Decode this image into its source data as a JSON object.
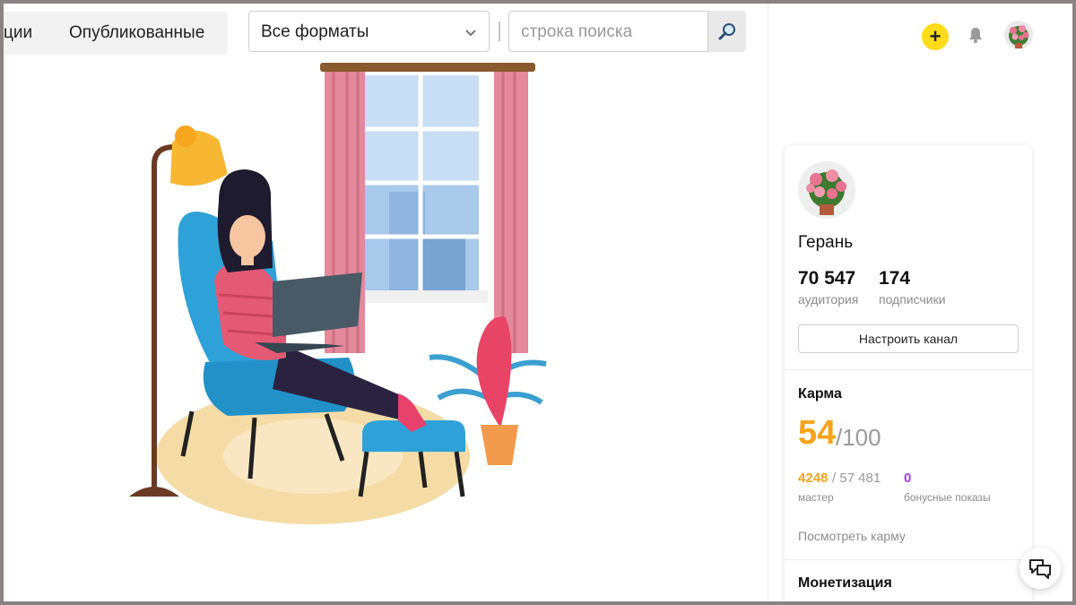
{
  "tabs": {
    "cut_label": "ции",
    "published_label": "Опубликованные"
  },
  "filter": {
    "format_selected": "Все форматы"
  },
  "search": {
    "placeholder": "строка поиска"
  },
  "header": {
    "add_symbol": "+"
  },
  "profile": {
    "channel_name": "Герань",
    "audience_value": "70 547",
    "audience_label": "аудитория",
    "subscribers_value": "174",
    "subscribers_label": "подписчики",
    "configure_label": "Настроить канал"
  },
  "karma": {
    "title": "Карма",
    "score": "54",
    "max": "/100",
    "points": "4248",
    "points_total": "/ 57 481",
    "level": "мастер",
    "bonus_value": "0",
    "bonus_label": "бонусные показы",
    "view_link": "Посмотреть карму"
  },
  "monetization": {
    "title": "Монетизация"
  },
  "colors": {
    "accent_yellow": "#ffdb1a",
    "karma_orange": "#f6a41b",
    "bonus_purple": "#a63dde"
  }
}
